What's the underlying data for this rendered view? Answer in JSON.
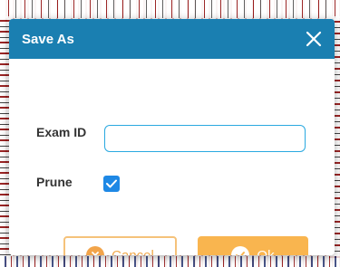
{
  "dialog": {
    "title": "Save As",
    "close_icon": "close-icon",
    "exam_id": {
      "label": "Exam ID",
      "value": "",
      "placeholder": ""
    },
    "prune": {
      "label": "Prune",
      "checked": true
    },
    "buttons": {
      "cancel_label": "Cancel",
      "cancel_icon": "close-circle-icon",
      "ok_label": "Ok",
      "ok_icon": "check-circle-icon"
    }
  },
  "colors": {
    "titlebar": "#1a7fb1",
    "accent": "#f9b54f",
    "checkbox": "#1e88e5",
    "input_border": "#2aa9e0"
  }
}
